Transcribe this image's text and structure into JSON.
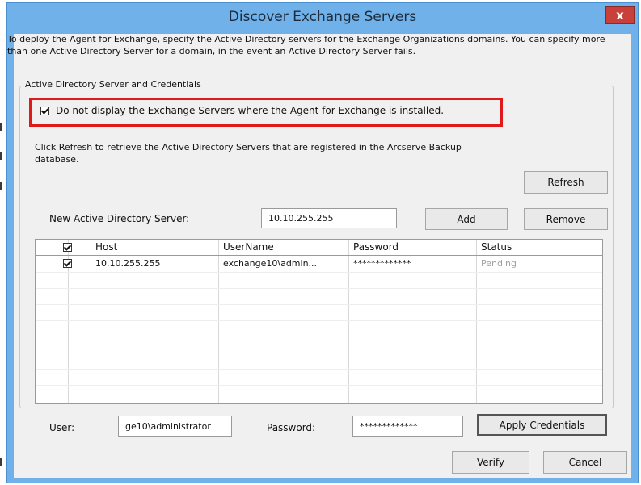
{
  "dialog": {
    "title": "Discover Exchange Servers",
    "close_glyph": "x"
  },
  "intro_text": "To deploy the Agent for Exchange, specify the Active Directory servers for the Exchange Organizations domains. You can specify more than one Active Directory Server for a domain, in the event an Active Directory Server fails.",
  "group": {
    "label": "Active Directory Server and Credentials",
    "hide_installed_option": {
      "label": "Do not display the Exchange Servers where the Agent for Exchange is installed.",
      "checked": true
    },
    "refresh_hint": "Click Refresh to retrieve the Active Directory Servers that are registered in the Arcserve Backup database.",
    "refresh_button": "Refresh",
    "new_server_label": "New Active Directory Server:",
    "new_server_value": "10.10.255.255",
    "add_button": "Add",
    "remove_button": "Remove",
    "table": {
      "columns": [
        "Host",
        "UserName",
        "Password",
        "Status"
      ],
      "rows": [
        {
          "checked": true,
          "host": "10.10.255.255",
          "username": "exchange10\\admin...",
          "password": "*************",
          "status": "Pending"
        }
      ]
    },
    "user_label": "User:",
    "user_value": "ge10\\administrator",
    "password_label": "Password:",
    "password_value": "*************",
    "apply_button": "Apply Credentials"
  },
  "buttons": {
    "verify": "Verify",
    "cancel": "Cancel"
  },
  "colors": {
    "title_bar": "#6fb1e8",
    "highlight_border": "#e01a1a",
    "close_button": "#c9403a",
    "status_pending": "#a0a0a0"
  }
}
